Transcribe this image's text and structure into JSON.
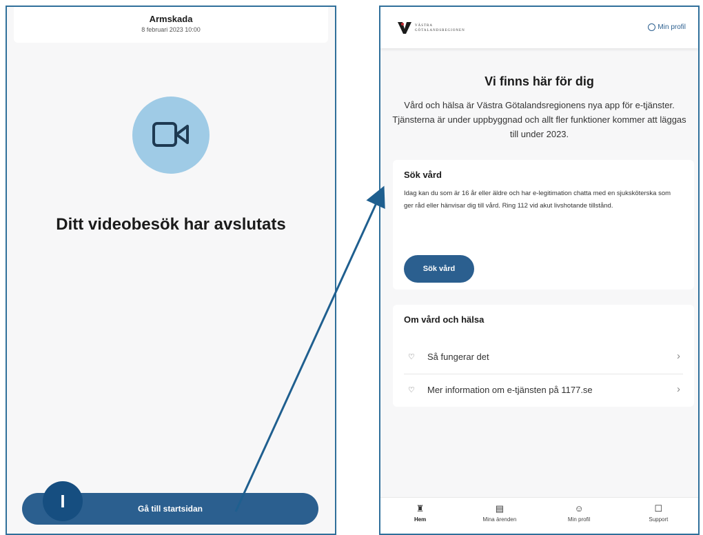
{
  "left": {
    "header": {
      "title": "Armskada",
      "date": "8 februari 2023 10:00"
    },
    "video_icon": "video-camera-icon",
    "ended_text": "Ditt videobesök har avslutats",
    "start_button": "Gå till startsidan",
    "step_badge": "I"
  },
  "right": {
    "logo_text_line1": "VÄSTRA",
    "logo_text_line2": "GÖTALANDSREGIONEN",
    "profile_link": "Min profil",
    "hero_title": "Vi finns här för dig",
    "hero_text": "Vård och hälsa är Västra Götalandsregionens nya app för e-tjänster. Tjänsterna är under uppbyggnad och allt fler funktioner kommer att läggas till under 2023.",
    "sok_card": {
      "title": "Sök vård",
      "text": "Idag kan du som är 16 år eller äldre och har e-legitimation chatta med en sjuksköterska som ger råd eller hänvisar dig till vård. Ring 112 vid akut livshotande tillstånd.",
      "button": "Sök vård"
    },
    "om_card": {
      "title": "Om vård och hälsa",
      "links": [
        {
          "label": "Så fungerar det",
          "icon": "heart-icon"
        },
        {
          "label": "Mer information om e-tjänsten på 1177.se",
          "icon": "heart-icon"
        }
      ]
    },
    "nav": [
      {
        "label": "Hem",
        "icon": "home-icon",
        "active": true
      },
      {
        "label": "Mina ärenden",
        "icon": "folder-icon",
        "active": false
      },
      {
        "label": "Min profil",
        "icon": "profile-icon",
        "active": false
      },
      {
        "label": "Support",
        "icon": "support-icon",
        "active": false
      }
    ]
  },
  "colors": {
    "primary": "#2b5f8f",
    "badge": "#164e80",
    "circle": "#9fcbe6",
    "frame": "#2f6f9a"
  }
}
